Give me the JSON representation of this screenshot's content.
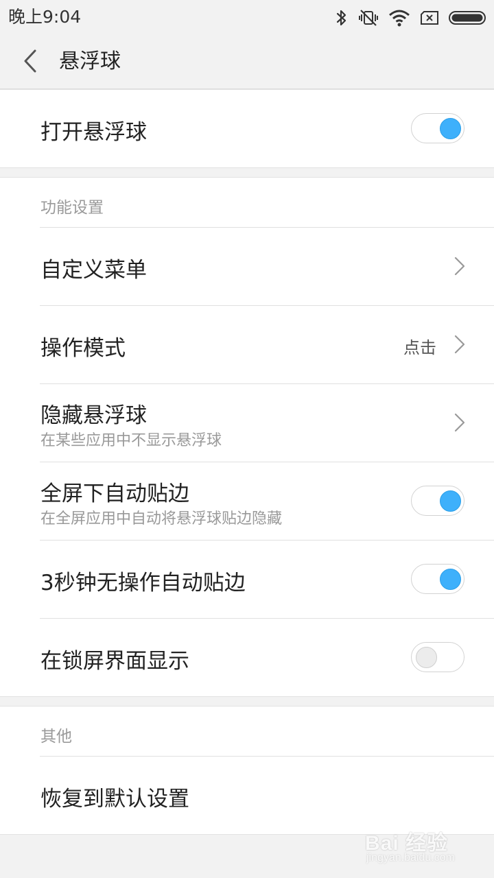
{
  "status_bar": {
    "time": "晚上9:04",
    "icons": [
      "bluetooth-icon",
      "vibrate-off-icon",
      "wifi-icon",
      "no-sim-icon",
      "battery-icon"
    ]
  },
  "header": {
    "back_icon": "chevron-left-icon",
    "title": "悬浮球"
  },
  "main_toggle": {
    "label": "打开悬浮球",
    "on": true
  },
  "function_settings": {
    "section_label": "功能设置",
    "items": [
      {
        "title": "自定义菜单",
        "type": "link"
      },
      {
        "title": "操作模式",
        "value": "点击",
        "type": "link"
      },
      {
        "title": "隐藏悬浮球",
        "subtitle": "在某些应用中不显示悬浮球",
        "type": "link"
      },
      {
        "title": "全屏下自动贴边",
        "subtitle": "在全屏应用中自动将悬浮球贴边隐藏",
        "type": "toggle",
        "on": true
      },
      {
        "title": "3秒钟无操作自动贴边",
        "type": "toggle",
        "on": true
      },
      {
        "title": "在锁屏界面显示",
        "type": "toggle",
        "on": false
      }
    ]
  },
  "other": {
    "section_label": "其他",
    "items": [
      {
        "title": "恢复到默认设置"
      }
    ]
  },
  "watermark": {
    "brand": "Bai 经验",
    "url": "jingyan.baidu.com"
  },
  "colors": {
    "accent": "#3eb0fb",
    "background": "#f2f2f2"
  }
}
